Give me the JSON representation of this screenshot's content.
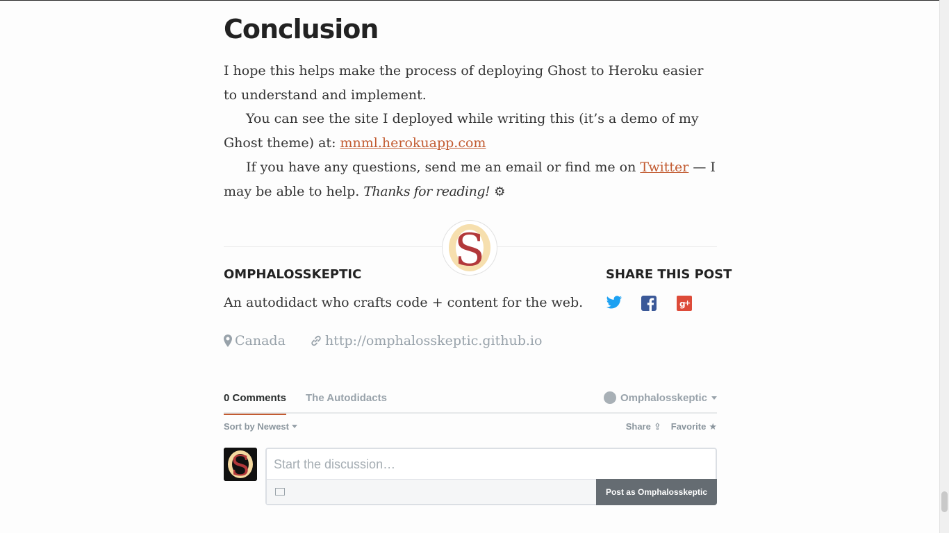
{
  "article": {
    "heading": "Conclusion",
    "p1": "I hope this helps make the process of deploying Ghost to Heroku easier to understand and implement.",
    "p2_before": "You can see the site I deployed while writing this (it’s a demo of my Ghost theme) at: ",
    "p2_link": "mnml.herokuapp.com",
    "p3_before": "If you have any questions, send me an email or find me on ",
    "p3_link": "Twitter",
    "p3_after": " — I may be able to help. ",
    "p3_thanks": "Thanks for reading!",
    "p3_gear": "⚙"
  },
  "author": {
    "name": "OMPHALOSSKEPTIC",
    "bio": "An autodidact who crafts code + content for the web.",
    "location": "Canada",
    "website": "http://omphalosskeptic.github.io",
    "logo_letter": "S"
  },
  "share": {
    "heading": "SHARE THIS POST",
    "items": [
      "twitter-icon",
      "facebook-icon",
      "google-plus-icon"
    ]
  },
  "comments": {
    "tab_comments": "0 Comments",
    "tab_community": "The Autodidacts",
    "user": "Omphalosskeptic",
    "sort": "Sort by Newest",
    "share": "Share",
    "favorite": "Favorite",
    "placeholder": "Start the discussion…",
    "post_button": "Post as Omphalosskeptic"
  },
  "colors": {
    "link": "#c25b31",
    "twitter": "#1da1f2",
    "facebook": "#3b5998",
    "google_plus": "#dd4b39",
    "logo_red": "#b2383a",
    "logo_cream": "#f5d9a0"
  }
}
